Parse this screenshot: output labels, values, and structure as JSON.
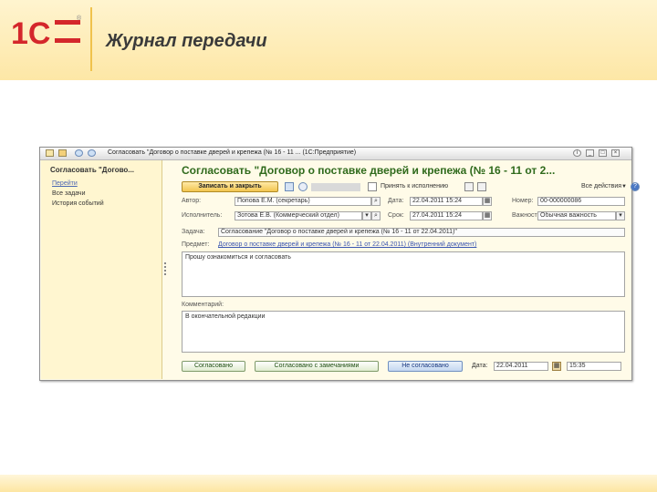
{
  "slide": {
    "title": "Журнал передачи"
  },
  "logo": {
    "text": "1С",
    "mark": "®"
  },
  "window": {
    "title": "Согласовать \"Договор о поставке дверей и крепежа (№ 16 - 11 ...  (1С:Предприятие)",
    "icons": [
      "app-menu-icon",
      "favorites-icon",
      "back-icon",
      "forward-icon"
    ],
    "controls": {
      "info": "i",
      "minimize": "_",
      "restore": "□",
      "close": "×"
    }
  },
  "sidebar": {
    "title": "Согласовать \"Догово...",
    "items": [
      {
        "label": "Перейти",
        "active": true
      },
      {
        "label": "Все задачи",
        "active": false
      },
      {
        "label": "История событий",
        "active": false
      }
    ]
  },
  "form": {
    "title": "Согласовать \"Договор о поставке дверей и крепежа (№ 16 - 11 от 2...",
    "toolbar": {
      "save_close": "Записать и закрыть",
      "accept": "Принять к исполнению",
      "all_actions": "Все действия",
      "help": "?"
    },
    "author": {
      "label": "Автор:",
      "value": "Попова Е.М. (секретарь)"
    },
    "date": {
      "label": "Дата:",
      "value": "22.04.2011 15:24"
    },
    "number": {
      "label": "Номер:",
      "value": "00-000000086"
    },
    "executor": {
      "label": "Исполнитель:",
      "value": "Зотова Е.В. (Коммерческий отдел)"
    },
    "deadline": {
      "label": "Срок:",
      "value": "27.04.2011 15:24"
    },
    "importance": {
      "label": "Важность:",
      "value": "Обычная важность"
    },
    "task": {
      "label": "Задача:",
      "value": "Согласование \"Договор о поставке дверей и крепежа (№ 16 - 11 от 22.04.2011)\""
    },
    "subject": {
      "label": "Предмет:",
      "value": "Договор о поставке дверей и крепежа (№ 16 - 11 от 22.04.2011) (Внутренний документ)"
    },
    "description": "Прошу ознакомиться и согласовать",
    "comment": {
      "label": "Комментарий:",
      "value": "В окончательной редакции"
    },
    "result": {
      "agreed": "Согласовано",
      "agreed_remarks": "Согласовано с замечаниями",
      "not_agreed": "Не согласовано",
      "date_label": "Дата:",
      "date_value": "22.04.2011",
      "time_value": "15:35"
    }
  }
}
